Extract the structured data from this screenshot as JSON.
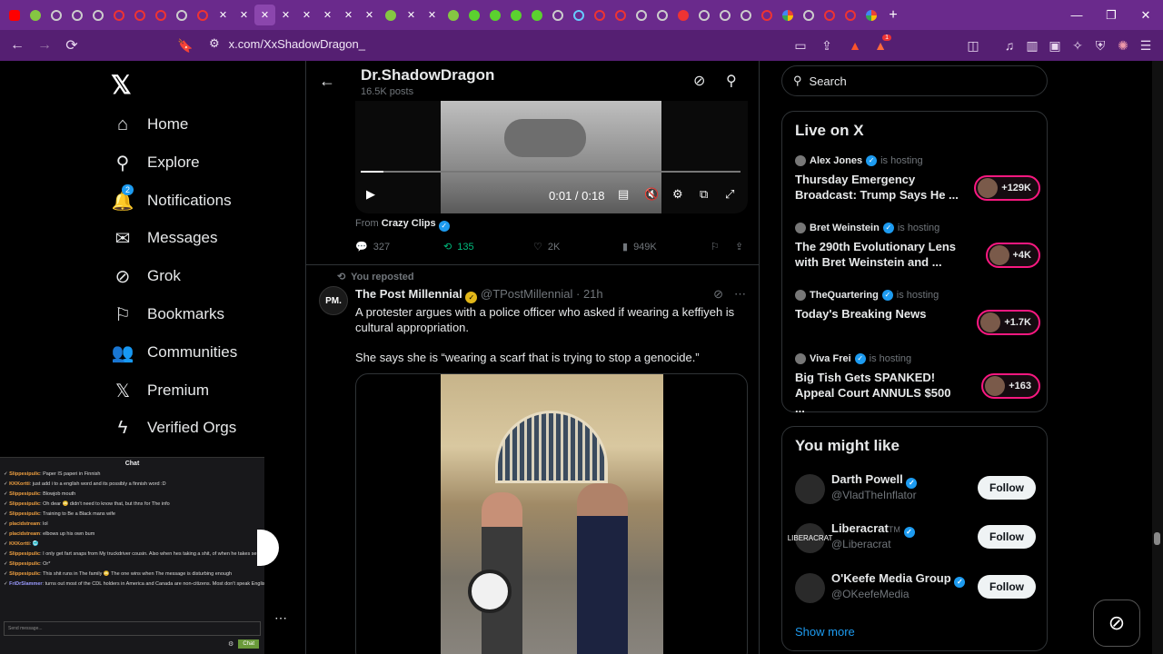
{
  "browser": {
    "url": "x.com/XxShadowDragon_",
    "new_tab": "+",
    "extension_badge": "1"
  },
  "nav": {
    "items": [
      {
        "label": "Home",
        "icon": "home-icon"
      },
      {
        "label": "Explore",
        "icon": "search-icon"
      },
      {
        "label": "Notifications",
        "icon": "bell-icon",
        "badge": "2"
      },
      {
        "label": "Messages",
        "icon": "mail-icon"
      },
      {
        "label": "Grok",
        "icon": "grok-icon"
      },
      {
        "label": "Bookmarks",
        "icon": "bookmark-icon"
      },
      {
        "label": "Communities",
        "icon": "people-icon"
      },
      {
        "label": "Premium",
        "icon": "x-icon"
      },
      {
        "label": "Verified Orgs",
        "icon": "bolt-icon"
      }
    ]
  },
  "chat": {
    "title": "Chat",
    "messages": [
      {
        "user": "Slippesipulic",
        "text": "Paper IS paperi in Finnish"
      },
      {
        "user": "KKKortti",
        "text": "just add i to a english word and its possibly a finnish word :D"
      },
      {
        "user": "Slippesipulic",
        "text": "Blowjob mouth"
      },
      {
        "user": "Slippesipulic",
        "text": "Oh dear 😳 didn't need to know that, but thnx for The info"
      },
      {
        "user": "Slippesipulic",
        "text": "Training to Be a Black mans wife"
      },
      {
        "user": "placidstream",
        "text": "lol"
      },
      {
        "user": "placidstream",
        "text": "elbows up his own bum"
      },
      {
        "user": "KKKortti",
        "text": "🥶"
      },
      {
        "user": "Slippesipulic",
        "text": "I only get fart snaps from My truckdriver cousin. Also when hes taking a shit, of when he takes se pic of his friends dick"
      },
      {
        "user": "Slippesipulic",
        "text": "Or*"
      },
      {
        "user": "Slippesipulic",
        "text": "This shit runs in The family 😳 The one wins when The message is disturbing enough"
      },
      {
        "user": "FriDrSlammer",
        "text": "turns out most of the CDL holders in America and Canada are non-citizens. Most don't speak English either"
      }
    ],
    "input_placeholder": "Send message...",
    "send_label": "Chat"
  },
  "profile_header": {
    "name": "Dr.ShadowDragon",
    "posts": "16.5K posts"
  },
  "video1": {
    "time": "0:01 / 0:18",
    "progress": 0.06
  },
  "tweet1": {
    "from_label": "From",
    "from_name": "Crazy Clips",
    "replies": "327",
    "reposts": "135",
    "likes": "2K",
    "views": "949K"
  },
  "tweet2": {
    "repost_label": "You reposted",
    "avatar_text": "PM.",
    "name": "The Post Millennial",
    "handle": "@TPostMillennial",
    "sep": "·",
    "time": "21h",
    "text1": "A protester argues with a police officer who asked if wearing a keffiyeh is cultural appropriation.",
    "text2": "She says she is “wearing a scarf that is trying to stop a genocide.”"
  },
  "search": {
    "placeholder": "Search"
  },
  "live": {
    "title": "Live on X",
    "hosting_label": "is hosting",
    "items": [
      {
        "host": "Alex Jones",
        "title": "Thursday Emergency Broadcast: Trump Says He ...",
        "count": "+129K"
      },
      {
        "host": "Bret Weinstein",
        "title": "The 290th Evolutionary Lens with Bret Weinstein and ...",
        "count": "+4K"
      },
      {
        "host": "TheQuartering",
        "title": "Today's Breaking News",
        "count": "+1.7K"
      },
      {
        "host": "Viva Frei",
        "title": "Big Tish Gets SPANKED! Appeal Court ANNULS $500 ...",
        "count": "+163"
      }
    ]
  },
  "suggestions": {
    "title": "You might like",
    "follow_label": "Follow",
    "show_more": "Show more",
    "items": [
      {
        "name": "Darth Powell",
        "handle": "@VladTheInflator"
      },
      {
        "name": "Liberacrat",
        "name_suffix": "TM",
        "handle": "@Liberacrat",
        "avatar_text": "LIBERACRAT"
      },
      {
        "name": "O'Keefe Media Group",
        "handle": "@OKeefeMedia"
      }
    ]
  }
}
